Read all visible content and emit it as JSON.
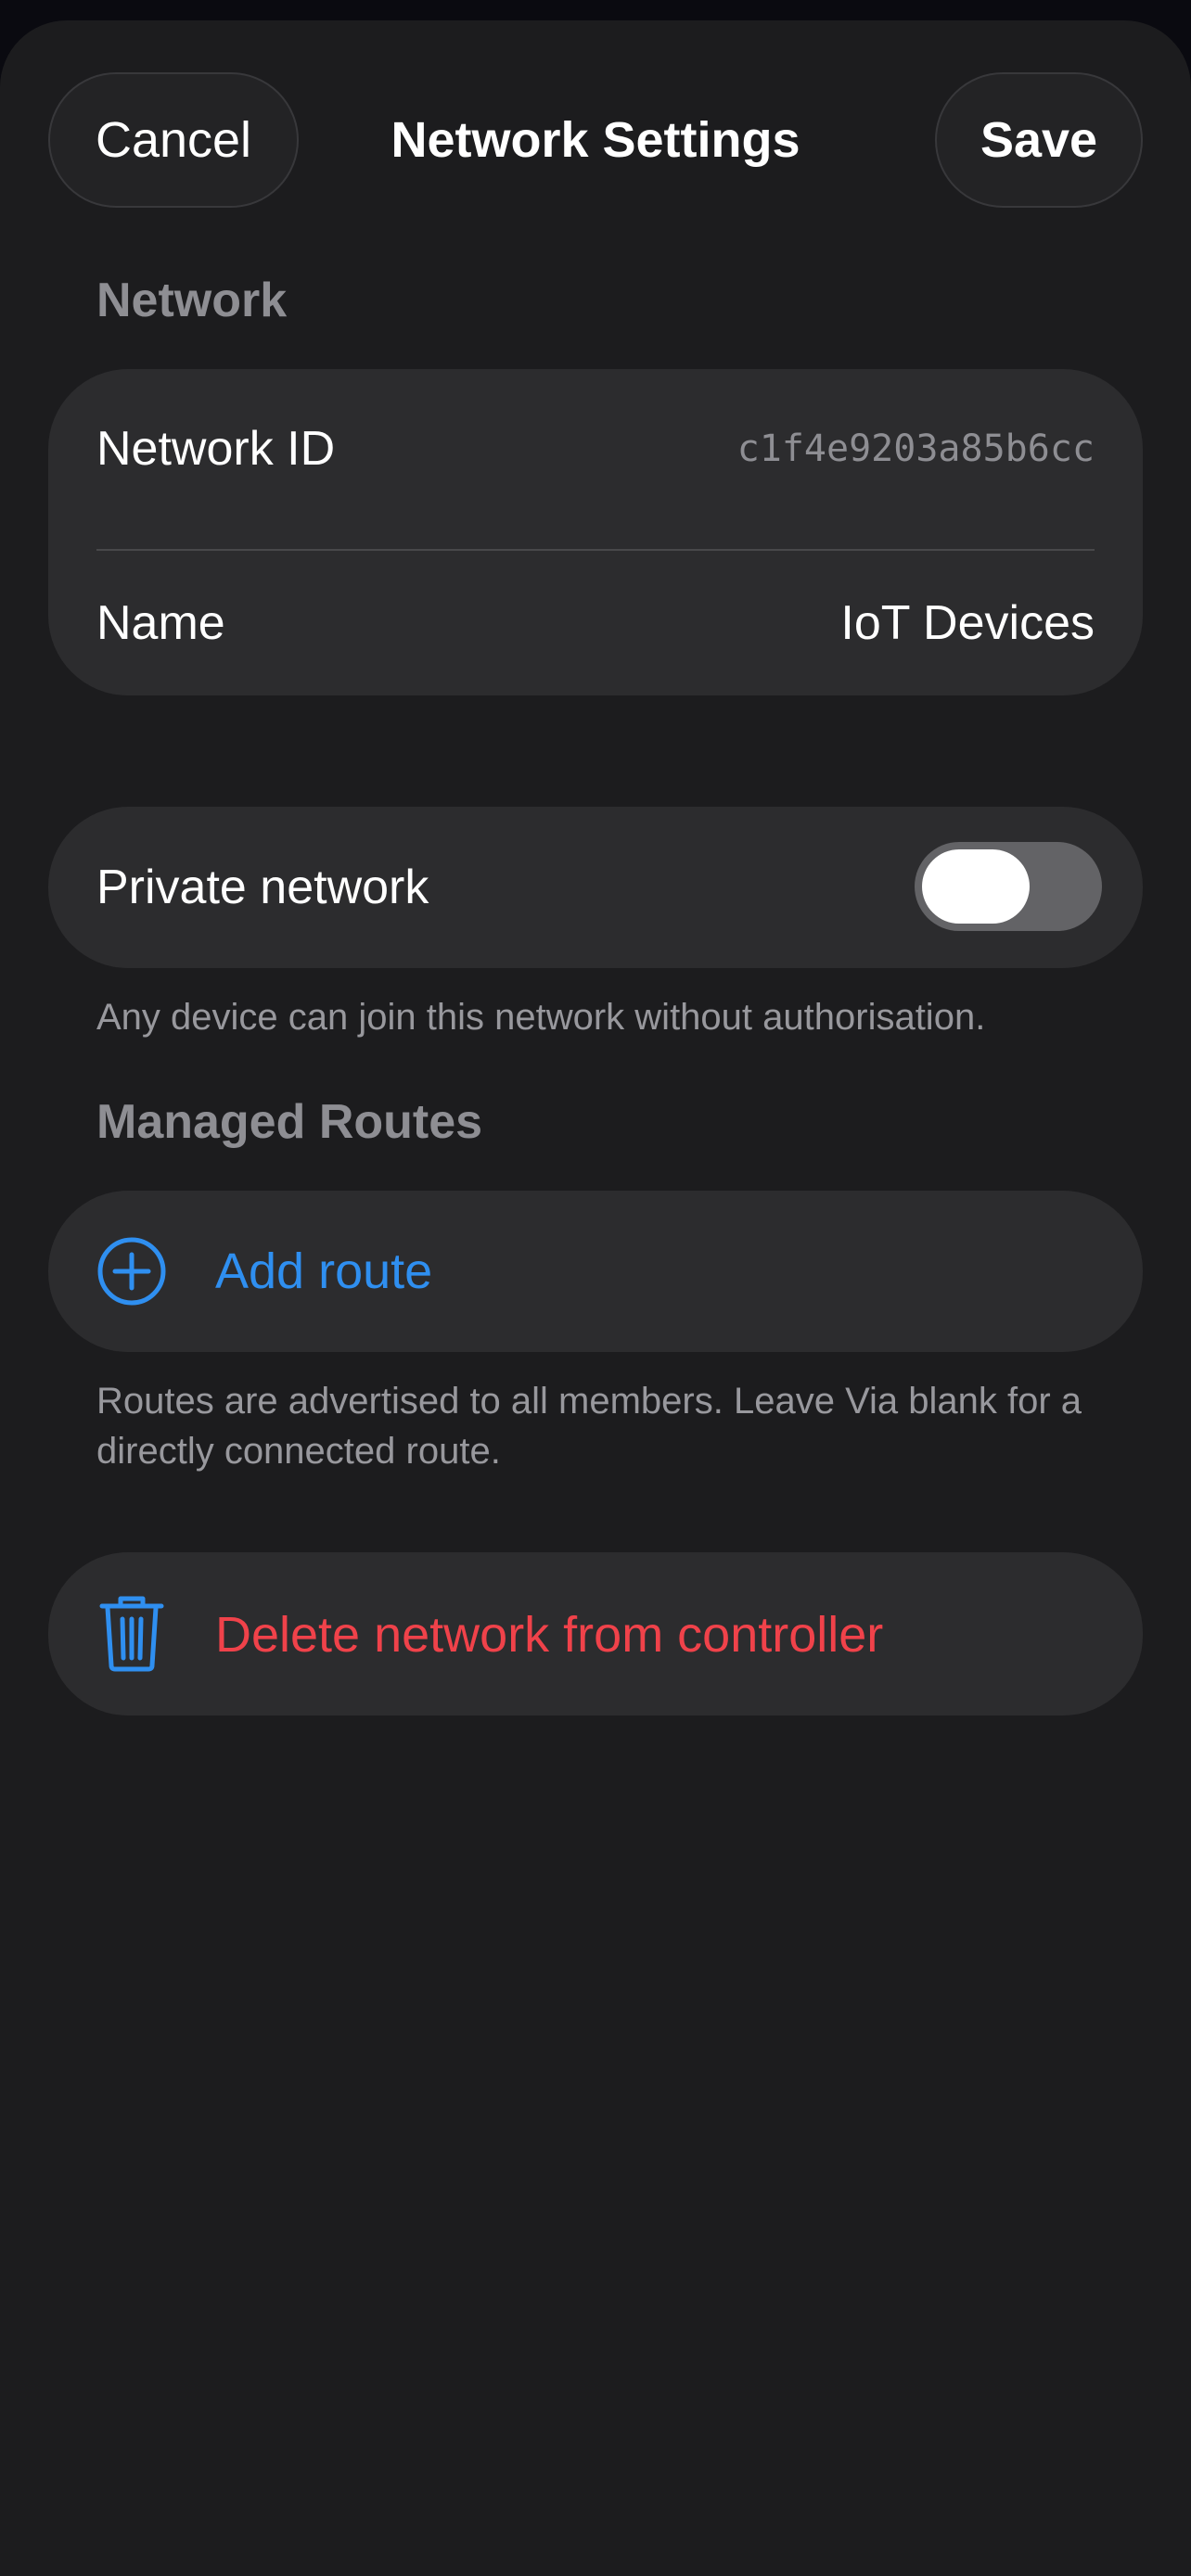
{
  "header": {
    "cancel_label": "Cancel",
    "title": "Network Settings",
    "save_label": "Save"
  },
  "network_section": {
    "label": "Network",
    "network_id_label": "Network ID",
    "network_id_value": "c1f4e9203a85b6cc",
    "name_label": "Name",
    "name_value": "IoT Devices"
  },
  "privacy": {
    "label": "Private network",
    "toggle_on": false,
    "note": "Any device can join this network without authorisation."
  },
  "routes_section": {
    "label": "Managed Routes",
    "add_route_label": "Add route",
    "add_icon": "plus-circle-icon",
    "note": "Routes are advertised to all members. Leave Via blank for a directly connected route."
  },
  "danger": {
    "delete_label": "Delete network from controller",
    "delete_icon": "trash-icon"
  },
  "colors": {
    "background": "#1c1c1e",
    "card": "#2c2c2e",
    "accent_blue": "#2f8ff0",
    "destructive_red": "#f0424a",
    "secondary_text": "#8e8e93"
  }
}
